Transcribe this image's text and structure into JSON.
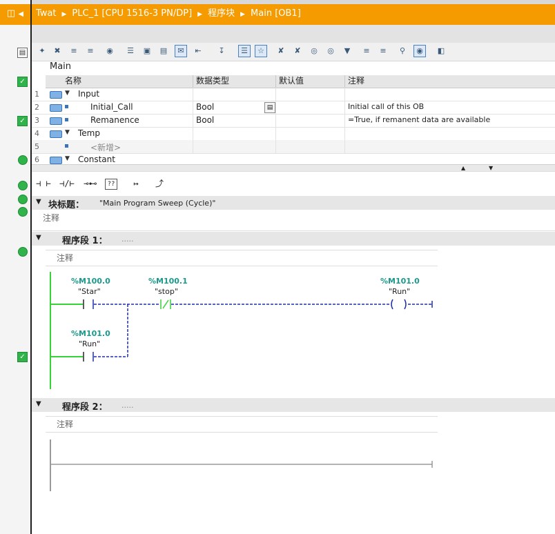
{
  "breadcrumb": {
    "items": [
      "Twat",
      "PLC_1 [CPU 1516-3 PN/DP]",
      "程序块",
      "Main [OB1]"
    ]
  },
  "block": {
    "name": "Main"
  },
  "interface": {
    "headers": [
      "名称",
      "数据类型",
      "默认值",
      "注释"
    ],
    "rows": [
      {
        "num": "1",
        "name": "Input",
        "type": "",
        "comment": ""
      },
      {
        "num": "2",
        "name": "Initial_Call",
        "type": "Bool",
        "comment": "Initial call of this OB"
      },
      {
        "num": "3",
        "name": "Remanence",
        "type": "Bool",
        "comment": "=True, if remanent data are available"
      },
      {
        "num": "4",
        "name": "Temp",
        "type": "",
        "comment": ""
      },
      {
        "num": "5",
        "name": "<新增>",
        "type": "",
        "comment": ""
      },
      {
        "num": "6",
        "name": "Constant",
        "type": "",
        "comment": ""
      }
    ]
  },
  "ladder_toolbar": {
    "items": [
      "⊣ ⊢",
      "⊣/⊢",
      "⊸⊷",
      "??",
      "↦",
      "⤴"
    ]
  },
  "block_title": {
    "label": "块标题：",
    "value": "\"Main Program Sweep (Cycle)\"",
    "comment": "注释"
  },
  "networks": [
    {
      "label": "程序段 1：",
      "dots": ".....",
      "comment": "注释",
      "contacts": [
        {
          "address": "%M100.0",
          "symbol": "\"Star\""
        },
        {
          "address": "%M100.1",
          "symbol": "\"stop\""
        },
        {
          "address": "%M101.0",
          "symbol": "\"Run\""
        }
      ],
      "coil": {
        "address": "%M101.0",
        "symbol": "\"Run\""
      }
    },
    {
      "label": "程序段 2：",
      "dots": ".....",
      "comment": "注释"
    }
  ],
  "colors": {
    "breadcrumb_bg": "#f59b00",
    "status_ok": "#2fb34a",
    "power_rail": "#35d335",
    "wire": "#1f2fa8",
    "operand": "#1a9a8a"
  }
}
